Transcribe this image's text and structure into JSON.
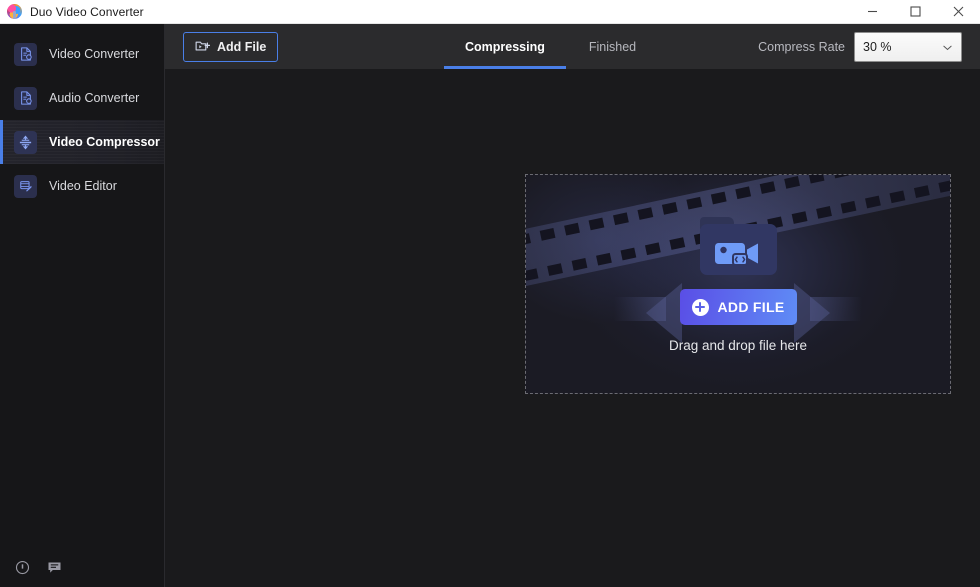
{
  "window": {
    "title": "Duo Video Converter",
    "logo_icon": "duo-app-logo-icon",
    "controls": {
      "minimize_icon": "minimize-icon",
      "maximize_icon": "maximize-icon",
      "close_icon": "close-icon"
    }
  },
  "colors": {
    "accent_blue": "#4a7fe8",
    "button_gradient_start": "#5a4ee6",
    "button_gradient_end": "#5f8cf6",
    "sidebar_bg": "#161618",
    "toolbar_bg": "#2b2b2d",
    "content_bg": "#1a1a1c",
    "dropzone_bg": "#1b1b24",
    "dropzone_border": "#6b6b72"
  },
  "sidebar": {
    "items": [
      {
        "label": "Video Converter",
        "icon": "file-convert-icon",
        "active": false
      },
      {
        "label": "Audio Converter",
        "icon": "file-convert-icon",
        "active": false
      },
      {
        "label": "Video Compressor",
        "icon": "compress-icon",
        "active": true
      },
      {
        "label": "Video Editor",
        "icon": "video-edit-icon",
        "active": false
      }
    ],
    "footer": [
      {
        "icon": "info-icon",
        "name": "info-button"
      },
      {
        "icon": "feedback-icon",
        "name": "feedback-button"
      }
    ]
  },
  "toolbar": {
    "add_file_label": "Add File",
    "add_file_icon": "folder-plus-icon",
    "tabs": [
      {
        "label": "Compressing",
        "active": true
      },
      {
        "label": "Finished",
        "active": false
      }
    ],
    "compress_rate_label": "Compress Rate",
    "compress_rate_value": "30 %",
    "compress_rate_caret_icon": "chevron-down-icon",
    "compress_rate_options": [
      "30 %"
    ]
  },
  "dropzone": {
    "add_file_cta": "ADD FILE",
    "add_file_cta_icon": "plus-circle-icon",
    "hint": "Drag and drop file here",
    "illustration": {
      "folder_icon": "folder-video-icon",
      "camera_icon": "video-camera-icon",
      "film_strip": "film-strip-decoration",
      "arrows": "compress-arrows-decoration"
    }
  }
}
